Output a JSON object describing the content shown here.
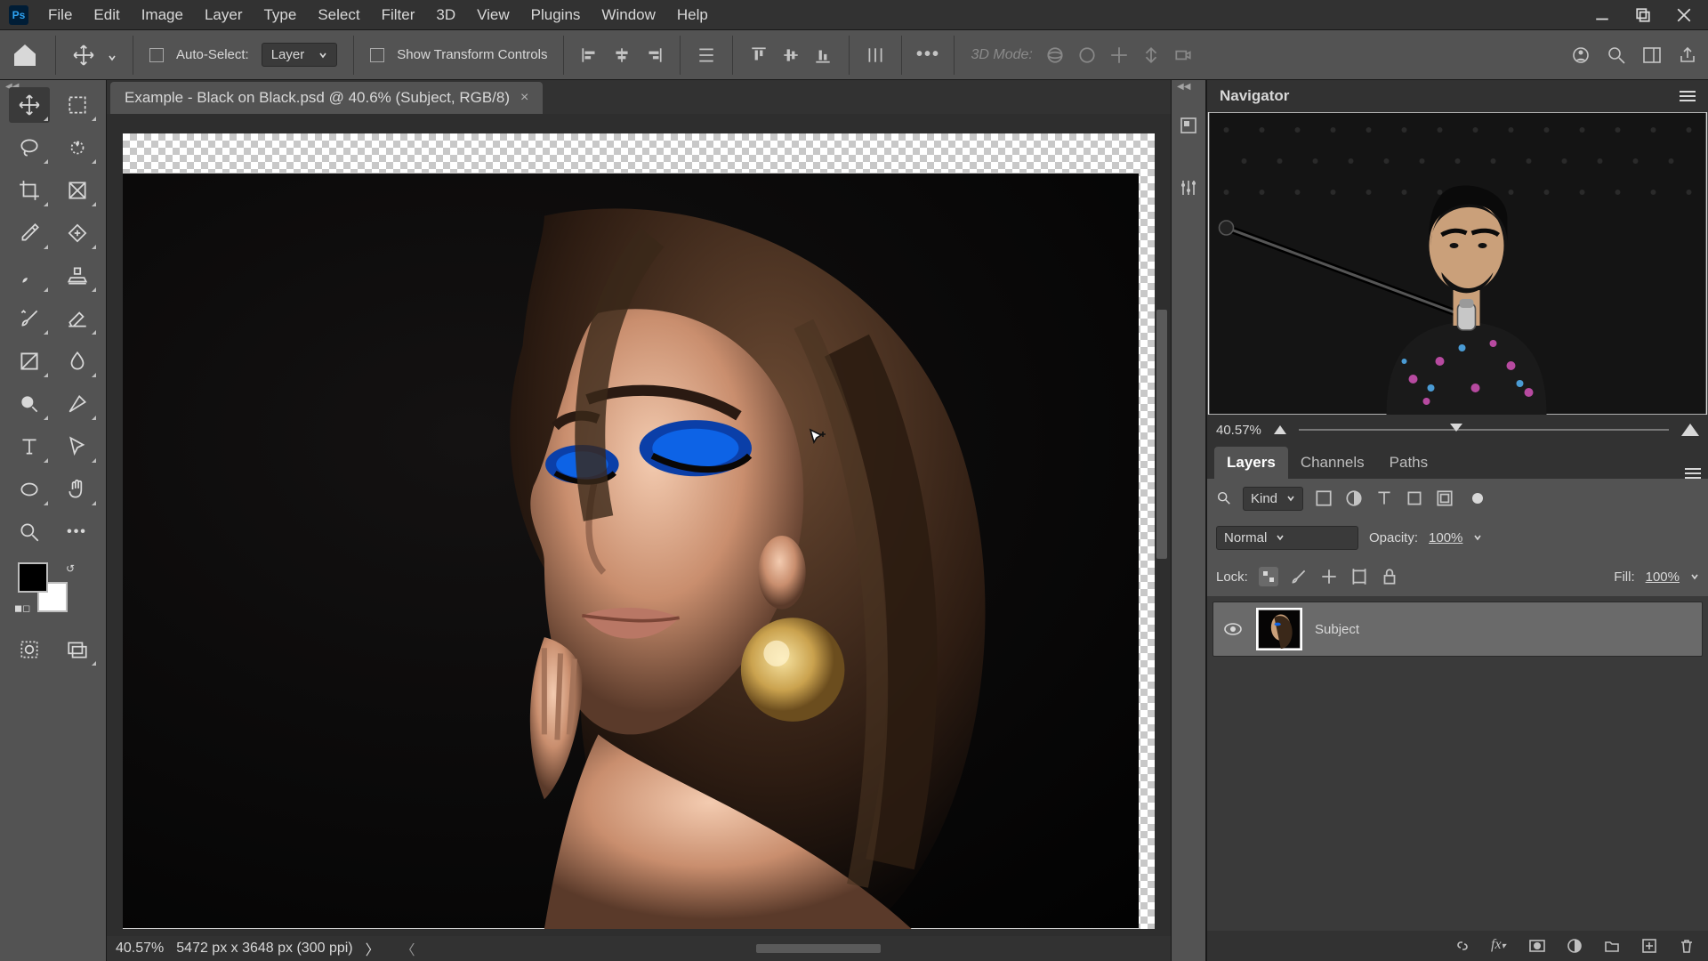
{
  "menu": {
    "items": [
      "File",
      "Edit",
      "Image",
      "Layer",
      "Type",
      "Select",
      "Filter",
      "3D",
      "View",
      "Plugins",
      "Window",
      "Help"
    ]
  },
  "opts": {
    "auto_select": "Auto-Select:",
    "layer_target": "Layer",
    "show_transform": "Show Transform Controls",
    "mode3d": "3D Mode:"
  },
  "doc": {
    "tab": "Example - Black on Black.psd @ 40.6% (Subject, RGB/8)",
    "zoom": "40.57%",
    "dims": "5472 px x 3648 px (300 ppi)"
  },
  "navigator": {
    "title": "Navigator",
    "zoom": "40.57%"
  },
  "layers_panel": {
    "tabs": [
      "Layers",
      "Channels",
      "Paths"
    ],
    "filter_kind": "Kind",
    "blend_mode": "Normal",
    "opacity_label": "Opacity:",
    "opacity_value": "100%",
    "lock_label": "Lock:",
    "fill_label": "Fill:",
    "fill_value": "100%",
    "layer_name": "Subject"
  }
}
